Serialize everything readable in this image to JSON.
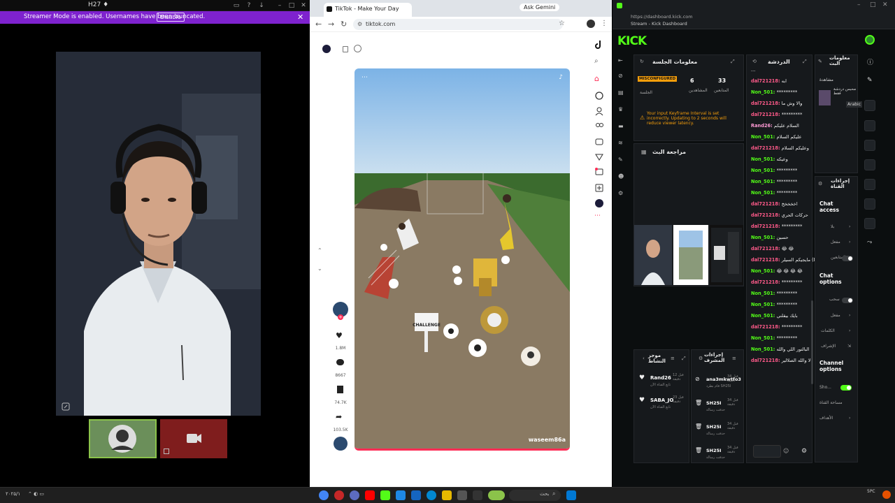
{
  "left_window": {
    "title": "H27 ♦",
    "banner_message": "Streamer Mode is enabled. Usernames have been truncated.",
    "disable_label": "Disable"
  },
  "tiktok_browser": {
    "tab_title": "TikTok - Make Your Day",
    "gemini_label": "Ask Gemini",
    "url": "tiktok.com",
    "video_username": "waseem86a",
    "challenge_text": "CHALLENGE",
    "counts": [
      "1.8M",
      "8667",
      "74.7K",
      "103.5K"
    ]
  },
  "kick": {
    "url": "https://dashboard.kick.com",
    "page_title": "Stream - Kick Dashboard",
    "logo": "KICK",
    "session_info_title": "معلومات الجلسة",
    "misconfigured_label": "MISCONFIGURED",
    "session_label": "الجلسة",
    "viewers_count": "6",
    "viewers_label": "المشاهدين",
    "followers_count": "33",
    "followers_label": "المتابعين",
    "keyframe_warning": "Your input Keyframe Interval is set incorrectly. Updating to 2 seconds will reduce viewer latency.",
    "stream_review_title": "مراجعة البث",
    "chat_title": "الدردشة",
    "stream_info_title": "معلومات البث",
    "stream_info_sub": "مشاهدة",
    "stream_info_desc": "محبس دردشة فقط",
    "language_badge": "Arabic",
    "channel_actions_title": "إجراءات القناة",
    "chat_access_label": "Chat access",
    "chat_options_label": "Chat options",
    "channel_options_label": "Channel options",
    "options": {
      "access_1": "بلا",
      "access_2": "مفعل",
      "access_3": "المتابعين",
      "chat_opt_1": "سحب",
      "chat_opt_2": "مفعل",
      "chat_opt_3": "الكلمات",
      "chat_opt_4": "الإشراف",
      "channel_opt_1": "Sho...",
      "channel_opt_2": "مساحة القناة",
      "channel_opt_3": "الأهداف"
    },
    "mod_actions_title": "إجراءات المشرف",
    "recent_events_title": "موجز النشاط",
    "events": [
      {
        "name": "Rand26",
        "detail": "تابع القناة الآن",
        "time": "قبل 12 دقيقة"
      },
      {
        "name": "SABA_JO",
        "detail": "تابع القناة الآن",
        "time": "قبل 23 دقيقة"
      }
    ],
    "mod_actions": [
      {
        "name": "ana3mkwtfo3",
        "detail": "قام بطرد SH25I",
        "time": "قبل 34 دقيقة"
      },
      {
        "name": "SH25I",
        "detail": "حذفت رسالة",
        "time": "قبل 34 دقيقة"
      },
      {
        "name": "SH25I",
        "detail": "حذفت رسالة",
        "time": "قبل 34 دقيقة"
      },
      {
        "name": "SH25I",
        "detail": "حذفت رسالة",
        "time": "قبل 34 دقيقة"
      }
    ],
    "chat_lines": [
      {
        "user": "",
        "text": "...",
        "cls": "m"
      },
      {
        "user": "dal721218:",
        "text": "ابه",
        "cls": "u1"
      },
      {
        "user": "Non_501:",
        "text": "*********",
        "cls": "u2"
      },
      {
        "user": "dal721218:",
        "text": "والا وش ما",
        "cls": "u1"
      },
      {
        "user": "dal721218:",
        "text": "*********",
        "cls": "u1"
      },
      {
        "user": "Rand26:",
        "text": "السلام عليكم",
        "cls": "u3"
      },
      {
        "user": "Non_501:",
        "text": "عليكم السلام",
        "cls": "u2"
      },
      {
        "user": "dal721218:",
        "text": "وعليكم السلام",
        "cls": "u1"
      },
      {
        "user": "Non_501:",
        "text": "وعيكه",
        "cls": "u2"
      },
      {
        "user": "Non_501:",
        "text": "*********",
        "cls": "u2"
      },
      {
        "user": "Non_501:",
        "text": "*********",
        "cls": "u2"
      },
      {
        "user": "Non_501:",
        "text": "*********",
        "cls": "u2"
      },
      {
        "user": "dal721218:",
        "text": "اخخخخخ",
        "cls": "u1"
      },
      {
        "user": "dal721218:",
        "text": "حركات الحري",
        "cls": "u1"
      },
      {
        "user": "dal721218:",
        "text": "*********",
        "cls": "u1"
      },
      {
        "user": "Non_501:",
        "text": "حسين",
        "cls": "u2"
      },
      {
        "user": "dal721218:",
        "text": "😂 😂",
        "cls": "u1"
      },
      {
        "user": "dal721218:",
        "text": "مايجيكم السيلر (Deleted)",
        "cls": "u1"
      },
      {
        "user": "Non_501:",
        "text": "😂 😂 😂 😂",
        "cls": "u2"
      },
      {
        "user": "dal721218:",
        "text": "*********",
        "cls": "u1"
      },
      {
        "user": "Non_501:",
        "text": "*********",
        "cls": "u2"
      },
      {
        "user": "Non_501:",
        "text": "*********",
        "cls": "u2"
      },
      {
        "user": "Non_501:",
        "text": "بايك بيقلني",
        "cls": "u2"
      },
      {
        "user": "dal721218:",
        "text": "*********",
        "cls": "u1"
      },
      {
        "user": "Non_501:",
        "text": "*********",
        "cls": "u2"
      },
      {
        "user": "Non_501:",
        "text": "البالتور اللي والله",
        "cls": "u2"
      },
      {
        "user": "dal721218:",
        "text": "لا والله الصلالير",
        "cls": "u1"
      }
    ]
  },
  "taskbar": {
    "search_placeholder": "بحث",
    "clock_time": "5PC",
    "clock_date": "۲۰۲۵/۱"
  },
  "colors": {
    "kick_green": "#53fc18",
    "banner_purple": "#7e22ce",
    "misconfigured": "#f59e0b",
    "tiktok_red": "#fe2c55"
  }
}
